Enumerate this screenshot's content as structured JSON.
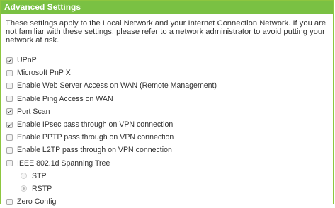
{
  "header": {
    "title": "Advanced Settings"
  },
  "description": "These settings apply to the Local Network and your Internet Connection Network. If you are not familiar with these settings, please refer to a network administrator to avoid putting your network at risk.",
  "options": [
    {
      "label": "UPnP",
      "checked": true
    },
    {
      "label": "Microsoft PnP X",
      "checked": false
    },
    {
      "label": "Enable Web Server Access on WAN (Remote Management)",
      "checked": false
    },
    {
      "label": "Enable Ping Access on WAN",
      "checked": false
    },
    {
      "label": "Port Scan",
      "checked": true
    },
    {
      "label": "Enable IPsec pass through on VPN connection",
      "checked": true
    },
    {
      "label": "Enable PPTP pass through on VPN connection",
      "checked": false
    },
    {
      "label": "Enable L2TP pass through on VPN connection",
      "checked": false
    },
    {
      "label": "IEEE 802.1d Spanning Tree",
      "checked": false
    }
  ],
  "spanning_tree_modes": [
    {
      "label": "STP",
      "selected": false
    },
    {
      "label": "RSTP",
      "selected": true
    }
  ],
  "zero_config": {
    "label": "Zero Config",
    "checked": false
  },
  "colors": {
    "header_bg": "#7ac143",
    "border": "#8dc63f"
  }
}
